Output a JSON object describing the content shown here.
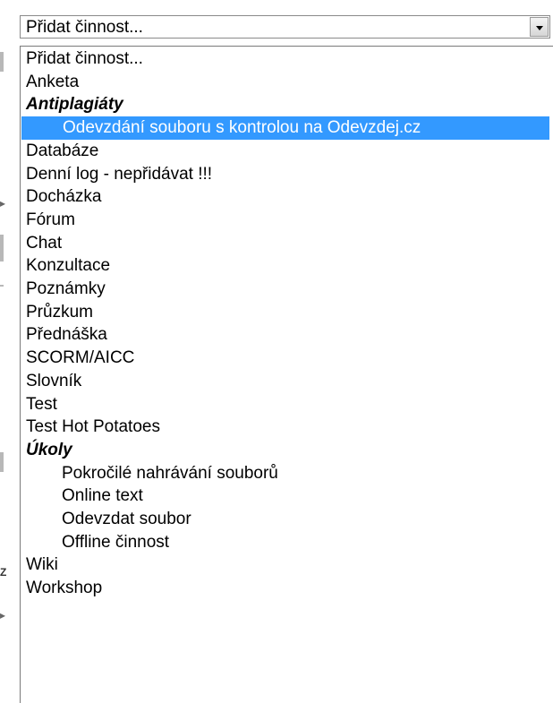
{
  "select": {
    "value": "Přidat činnost...",
    "arrow_icon": "chevron-down-icon"
  },
  "options": [
    {
      "label": "Přidat činnost...",
      "kind": "option"
    },
    {
      "label": "Anketa",
      "kind": "option"
    },
    {
      "label": "Antiplagiáty",
      "kind": "group"
    },
    {
      "label": "Odevzdání souboru s kontrolou na Odevzdej.cz",
      "kind": "indent",
      "selected": true
    },
    {
      "label": "Databáze",
      "kind": "option"
    },
    {
      "label": "Denní log - nepřidávat !!!",
      "kind": "option"
    },
    {
      "label": "Docházka",
      "kind": "option"
    },
    {
      "label": "Fórum",
      "kind": "option"
    },
    {
      "label": "Chat",
      "kind": "option"
    },
    {
      "label": "Konzultace",
      "kind": "option"
    },
    {
      "label": "Poznámky",
      "kind": "option"
    },
    {
      "label": "Průzkum",
      "kind": "option"
    },
    {
      "label": "Přednáška",
      "kind": "option"
    },
    {
      "label": "SCORM/AICC",
      "kind": "option"
    },
    {
      "label": "Slovník",
      "kind": "option"
    },
    {
      "label": "Test",
      "kind": "option"
    },
    {
      "label": "Test Hot Potatoes",
      "kind": "option"
    },
    {
      "label": "Úkoly",
      "kind": "group"
    },
    {
      "label": "Pokročilé nahrávání souborů",
      "kind": "indent"
    },
    {
      "label": "Online text",
      "kind": "indent"
    },
    {
      "label": "Odevzdat soubor",
      "kind": "indent"
    },
    {
      "label": "Offline činnost",
      "kind": "indent"
    },
    {
      "label": "Wiki",
      "kind": "option"
    },
    {
      "label": "Workshop",
      "kind": "option"
    }
  ],
  "colors": {
    "selected_bg": "#3399ff",
    "selected_fg": "#ffffff",
    "border": "#8a8a8a"
  }
}
